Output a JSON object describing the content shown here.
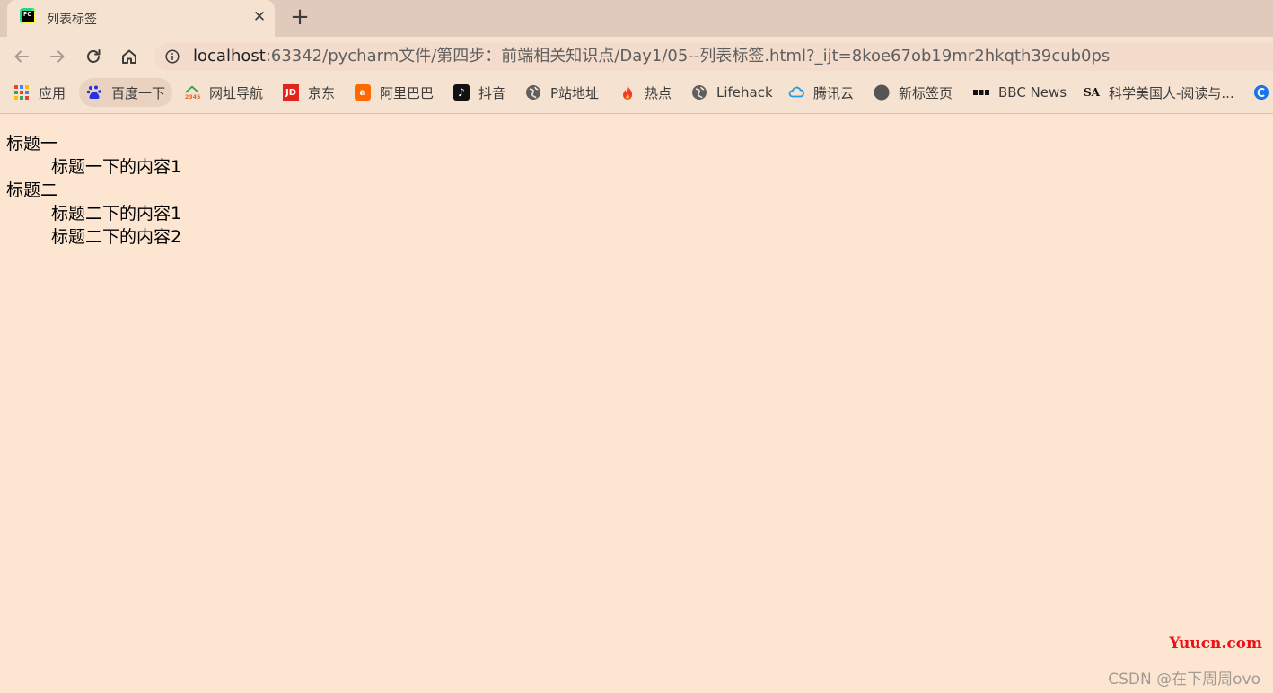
{
  "tab": {
    "title": "列表标签",
    "favicon_text": "PC"
  },
  "toolbar": {
    "back_icon": "arrow-left-icon",
    "forward_icon": "arrow-right-icon",
    "reload_icon": "reload-icon",
    "home_icon": "home-icon",
    "url_host": "localhost",
    "url_rest": ":63342/pycharm文件/第四步：前端相关知识点/Day1/05--列表标签.html?_ijt=8koe67ob19mr2hkqth39cub0ps"
  },
  "bookmarks": [
    {
      "label": "应用",
      "icon": "apps-grid-icon"
    },
    {
      "label": "百度一下",
      "icon": "baidu-paw-icon"
    },
    {
      "label": "网址导航",
      "icon": "2345-house-icon"
    },
    {
      "label": "京东",
      "icon": "jd-icon"
    },
    {
      "label": "阿里巴巴",
      "icon": "alibaba-icon"
    },
    {
      "label": "抖音",
      "icon": "douyin-icon"
    },
    {
      "label": "P站地址",
      "icon": "globe-icon"
    },
    {
      "label": "热点",
      "icon": "flame-icon"
    },
    {
      "label": "Lifehack",
      "icon": "globe-icon"
    },
    {
      "label": "腾讯云",
      "icon": "tencent-cloud-icon"
    },
    {
      "label": "新标签页",
      "icon": "dark-circle-icon"
    },
    {
      "label": "BBC News",
      "icon": "bbc-icon"
    },
    {
      "label": "科学美国人-阅读与...",
      "icon": "sa-icon"
    }
  ],
  "content": {
    "dt1": "标题一",
    "dd1_1": "标题一下的内容1",
    "dt2": "标题二",
    "dd2_1": "标题二下的内容1",
    "dd2_2": "标题二下的内容2"
  },
  "watermark": {
    "site": "Yuucn.com",
    "author": "CSDN @在下周周ovo"
  },
  "colors": {
    "page_background": "#fde6d1",
    "tab_strip": "#dfcabb",
    "toolbar": "#f6e2d0",
    "watermark_site": "#e8131a"
  }
}
